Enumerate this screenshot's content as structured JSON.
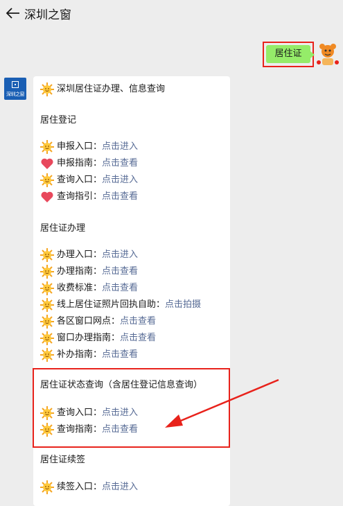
{
  "header": {
    "title": "深圳之窗"
  },
  "user_message": "居住证",
  "brand": {
    "logo_text": "深圳之窗"
  },
  "reply": {
    "intro": "深圳居住证办理、信息查询",
    "sections": [
      {
        "title": "居住登记",
        "items": [
          {
            "icon": "sun",
            "label": "申报入口：",
            "link": "点击进入"
          },
          {
            "icon": "heart",
            "label": "申报指南：",
            "link": "点击查看"
          },
          {
            "icon": "sun",
            "label": "查询入口：",
            "link": "点击进入"
          },
          {
            "icon": "heart",
            "label": "查询指引：",
            "link": "点击查看"
          }
        ]
      },
      {
        "title": "居住证办理",
        "items": [
          {
            "icon": "sun",
            "label": "办理入口：",
            "link": "点击进入"
          },
          {
            "icon": "sun",
            "label": "办理指南：",
            "link": "点击查看"
          },
          {
            "icon": "sun",
            "label": "收费标准：",
            "link": "点击查看"
          },
          {
            "icon": "sun",
            "label": "线上居住证照片回执自助：",
            "link": "点击拍摄"
          },
          {
            "icon": "sun",
            "label": "各区窗口网点：",
            "link": "点击查看"
          },
          {
            "icon": "sun",
            "label": "窗口办理指南：",
            "link": "点击查看"
          },
          {
            "icon": "sun",
            "label": "补办指南：",
            "link": "点击查看"
          }
        ]
      },
      {
        "title": "居住证状态查询（含居住登记信息查询）",
        "items": [
          {
            "icon": "sun",
            "label": "查询入口：",
            "link": "点击进入"
          },
          {
            "icon": "sun",
            "label": "查询指南：",
            "link": "点击查看"
          }
        ]
      },
      {
        "title": "居住证续签",
        "items": [
          {
            "icon": "sun",
            "label": "续签入口：",
            "link": "点击进入"
          }
        ]
      }
    ]
  },
  "colors": {
    "link": "#576b95",
    "user_bubble": "#95ec69",
    "highlight": "#e8221b",
    "brand": "#1a5fb4"
  }
}
